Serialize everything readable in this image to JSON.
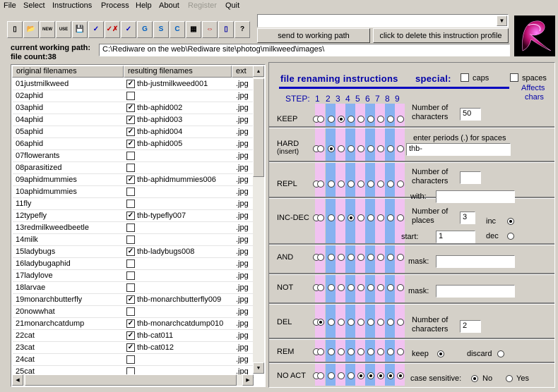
{
  "menu": {
    "items": [
      {
        "label": "File",
        "enabled": true
      },
      {
        "label": "Select",
        "enabled": true
      },
      {
        "label": "Instructions",
        "enabled": true
      },
      {
        "label": "Process",
        "enabled": true
      },
      {
        "label": "Help",
        "enabled": true
      },
      {
        "label": "About",
        "enabled": true
      },
      {
        "label": "Register",
        "enabled": false
      },
      {
        "label": "Quit",
        "enabled": true
      }
    ]
  },
  "toolbar": {
    "buttons": [
      {
        "icon": "new-document-icon",
        "glyph": "▯"
      },
      {
        "icon": "open-folder-icon",
        "glyph": "📂"
      },
      {
        "icon": "new-profile-icon",
        "glyph": "NEW"
      },
      {
        "icon": "use-profile-icon",
        "glyph": "USE"
      },
      {
        "icon": "save-icon",
        "glyph": "💾"
      },
      {
        "icon": "check-icon",
        "glyph": "✓"
      },
      {
        "icon": "check-x-icon",
        "glyph": "✓✗"
      },
      {
        "icon": "check-down-icon",
        "glyph": "✓"
      },
      {
        "icon": "g-icon",
        "glyph": "G"
      },
      {
        "icon": "s-icon",
        "glyph": "S"
      },
      {
        "icon": "c-icon",
        "glyph": "C"
      },
      {
        "icon": "calculator-icon",
        "glyph": "▦"
      },
      {
        "icon": "swap-arrows-icon",
        "glyph": "⇔"
      },
      {
        "icon": "page-icon",
        "glyph": "▯"
      },
      {
        "icon": "help-icon",
        "glyph": "?"
      }
    ],
    "profile_combo_value": "",
    "send_button": "send to working path",
    "delete_button": "click to delete this instruction profile"
  },
  "path": {
    "label": "current working path:",
    "value": "C:\\Rediware on the web\\Rediware site\\photog\\milkweed\\images\\",
    "file_count_label": "file count:",
    "file_count": "38"
  },
  "table": {
    "headers": {
      "original": "original filenames",
      "result": "resulting filenames",
      "ext": "ext"
    },
    "rows": [
      {
        "original": "01justmilkweed",
        "checked": true,
        "result": "thb-justmilkweed001",
        "ext": ".jpg"
      },
      {
        "original": "02aphid",
        "checked": false,
        "result": "",
        "ext": ".jpg"
      },
      {
        "original": "03aphid",
        "checked": true,
        "result": "thb-aphid002",
        "ext": ".jpg"
      },
      {
        "original": "04aphid",
        "checked": true,
        "result": "thb-aphid003",
        "ext": ".jpg"
      },
      {
        "original": "05aphid",
        "checked": true,
        "result": "thb-aphid004",
        "ext": ".jpg"
      },
      {
        "original": "06aphid",
        "checked": true,
        "result": "thb-aphid005",
        "ext": ".jpg"
      },
      {
        "original": "07flowerants",
        "checked": false,
        "result": "",
        "ext": ".jpg"
      },
      {
        "original": "08parasitized",
        "checked": false,
        "result": "",
        "ext": ".jpg"
      },
      {
        "original": "09aphidmummies",
        "checked": true,
        "result": "thb-aphidmummies006",
        "ext": ".jpg"
      },
      {
        "original": "10aphidmummies",
        "checked": false,
        "result": "",
        "ext": ".jpg"
      },
      {
        "original": "11fly",
        "checked": false,
        "result": "",
        "ext": ".jpg"
      },
      {
        "original": "12typefly",
        "checked": true,
        "result": "thb-typefly007",
        "ext": ".jpg"
      },
      {
        "original": "13redmilkweedbeetle",
        "checked": false,
        "result": "",
        "ext": ".jpg"
      },
      {
        "original": "14milk",
        "checked": false,
        "result": "",
        "ext": ".jpg"
      },
      {
        "original": "15ladybugs",
        "checked": true,
        "result": "thb-ladybugs008",
        "ext": ".jpg"
      },
      {
        "original": "16ladybugaphid",
        "checked": false,
        "result": "",
        "ext": ".jpg"
      },
      {
        "original": "17ladylove",
        "checked": false,
        "result": "",
        "ext": ".jpg"
      },
      {
        "original": "18larvae",
        "checked": false,
        "result": "",
        "ext": ".jpg"
      },
      {
        "original": "19monarchbutterfly",
        "checked": true,
        "result": "thb-monarchbutterfly009",
        "ext": ".jpg"
      },
      {
        "original": "20nowwhat",
        "checked": false,
        "result": "",
        "ext": ".jpg"
      },
      {
        "original": "21monarchcatdump",
        "checked": true,
        "result": "thb-monarchcatdump010",
        "ext": ".jpg"
      },
      {
        "original": "22cat",
        "checked": true,
        "result": "thb-cat011",
        "ext": ".jpg"
      },
      {
        "original": "23cat",
        "checked": true,
        "result": "thb-cat012",
        "ext": ".jpg"
      },
      {
        "original": "24cat",
        "checked": false,
        "result": "",
        "ext": ".jpg"
      },
      {
        "original": "25cat",
        "checked": false,
        "result": "",
        "ext": ".jpg"
      }
    ]
  },
  "instructions": {
    "title": "file renaming instructions",
    "special_label": "special:",
    "caps_label": "caps",
    "spaces_label": "spaces",
    "affects_label": "Affects",
    "chars_label": "chars",
    "step_label": "STEP:",
    "steps": [
      "1",
      "2",
      "3",
      "4",
      "5",
      "6",
      "7",
      "8",
      "9"
    ],
    "ops": [
      {
        "label": "KEEP",
        "selected_step": 3
      },
      {
        "label": "HARD",
        "sublabel": "(insert)",
        "selected_step": 2
      },
      {
        "label": "REPL",
        "selected_step": 0
      },
      {
        "label": "INC-DEC",
        "selected_step": 4
      },
      {
        "label": "AND",
        "selected_step": 0
      },
      {
        "label": "NOT",
        "selected_step": 0
      },
      {
        "label": "DEL",
        "selected_step": 1
      },
      {
        "label": "REM",
        "selected_step": 0
      },
      {
        "label": "NO ACT",
        "selected_steps": [
          5,
          6,
          7,
          8,
          9
        ]
      }
    ],
    "keep": {
      "label1": "Number of",
      "label2": "characters",
      "value": "50"
    },
    "hard": {
      "label": "enter periods (.) for spaces",
      "value": "thb-"
    },
    "repl": {
      "label1": "Number of",
      "label2": "characters",
      "value": "",
      "with_label": "with:",
      "with_value": ""
    },
    "incdec": {
      "label1": "Number of",
      "label2": "places",
      "places": "3",
      "inc_label": "inc",
      "dec_label": "dec",
      "start_label": "start:",
      "start": "1",
      "mode": "inc"
    },
    "and": {
      "mask_label": "mask:",
      "mask": ""
    },
    "not": {
      "mask_label": "mask:",
      "mask": ""
    },
    "del": {
      "label1": "Number of",
      "label2": "characters",
      "value": "2"
    },
    "rem": {
      "keep_label": "keep",
      "discard_label": "discard",
      "mode": "keep"
    },
    "noact": {
      "case_label": "case sensitive:",
      "no_label": "No",
      "yes_label": "Yes",
      "mode": "No"
    },
    "colors": {
      "blue_stripe": "#87b2f0",
      "pink_stripe": "#f1c2f1",
      "title": "#0000a8"
    }
  }
}
